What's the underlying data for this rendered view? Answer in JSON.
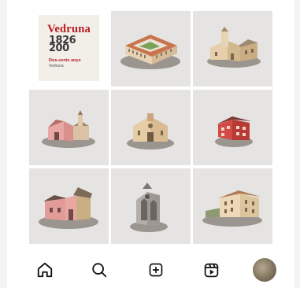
{
  "brand_post": {
    "title": "Vedruna",
    "years_top": "1826",
    "years_bottom": "200",
    "subtitle": "Dos-cents anys",
    "subtitle2": "Vedruna"
  },
  "posts": [
    {
      "name": "post-brand-logo"
    },
    {
      "name": "post-cloister-building",
      "icon": "cloister-illustration"
    },
    {
      "name": "post-church-belltower",
      "icon": "church-illustration"
    },
    {
      "name": "post-pink-church",
      "icon": "pink-church-illustration"
    },
    {
      "name": "post-beige-church",
      "icon": "beige-church-illustration"
    },
    {
      "name": "post-red-house",
      "icon": "red-house-illustration"
    },
    {
      "name": "post-pink-house-church",
      "icon": "pink-house-illustration"
    },
    {
      "name": "post-gothic-church",
      "icon": "gothic-church-illustration"
    },
    {
      "name": "post-manor-house",
      "icon": "manor-illustration"
    }
  ],
  "nav": {
    "items": [
      "home-icon",
      "search-icon",
      "create-icon",
      "reels-icon",
      "profile-avatar"
    ]
  }
}
